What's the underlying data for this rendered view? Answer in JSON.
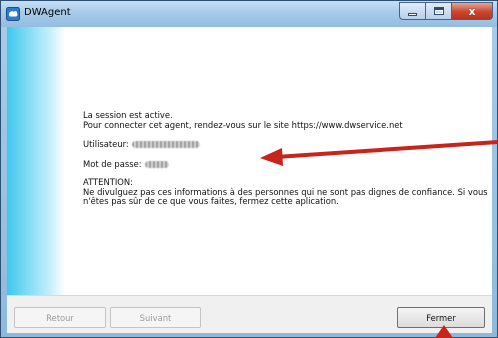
{
  "window": {
    "title": "DWAgent",
    "close_glyph": "x"
  },
  "content": {
    "status_line": "La session est active.",
    "connect_line": "Pour connecter cet agent, rendez-vous sur le site https://www.dwservice.net",
    "user_label": "Utilisateur:",
    "password_label": "Mot de passe:",
    "warning_title": "ATTENTION:",
    "warning_text": "Ne divulguez pas ces informations à des personnes qui ne sont pas dignes de confiance. Si vous n'êtes pas sûr de ce que vous faites, fermez cette aplication."
  },
  "buttons": {
    "back_label": "Retour",
    "next_label": "Suivant",
    "close_label": "Fermer"
  },
  "colors": {
    "annotation_arrow": "#c8241c",
    "side_panel": "#3fc6ec"
  },
  "icons": {
    "app": "dwagent-app-icon",
    "minimize": "minimize-icon",
    "maximize": "maximize-icon",
    "close": "close-icon",
    "arrow": "red-arrow-icon"
  }
}
